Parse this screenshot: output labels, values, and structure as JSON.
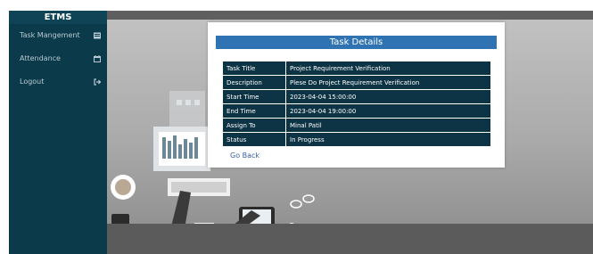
{
  "sidebar": {
    "brand": "ETMS",
    "items": [
      {
        "label": "Task Mangement",
        "icon": "list-icon"
      },
      {
        "label": "Attendance",
        "icon": "calendar-icon"
      },
      {
        "label": "Logout",
        "icon": "logout-icon"
      }
    ]
  },
  "modal": {
    "title": "Task Details",
    "rows": [
      {
        "label": "Task Title",
        "value": "Project Requirement Verification"
      },
      {
        "label": "Description",
        "value": "Plese Do Project Requirement Verification"
      },
      {
        "label": "Start Time",
        "value": "2023-04-04 15:00:00"
      },
      {
        "label": "End Time",
        "value": "2023-04-04 19:00:00"
      },
      {
        "label": "Assign To",
        "value": "Minal Patil"
      },
      {
        "label": "Status",
        "value": "In Progress"
      }
    ],
    "go_back": "Go Back"
  },
  "colors": {
    "sidebar": "#0b3a4a",
    "header": "#2f73b3",
    "table": "#0d3444",
    "link": "#3a5ea5"
  }
}
